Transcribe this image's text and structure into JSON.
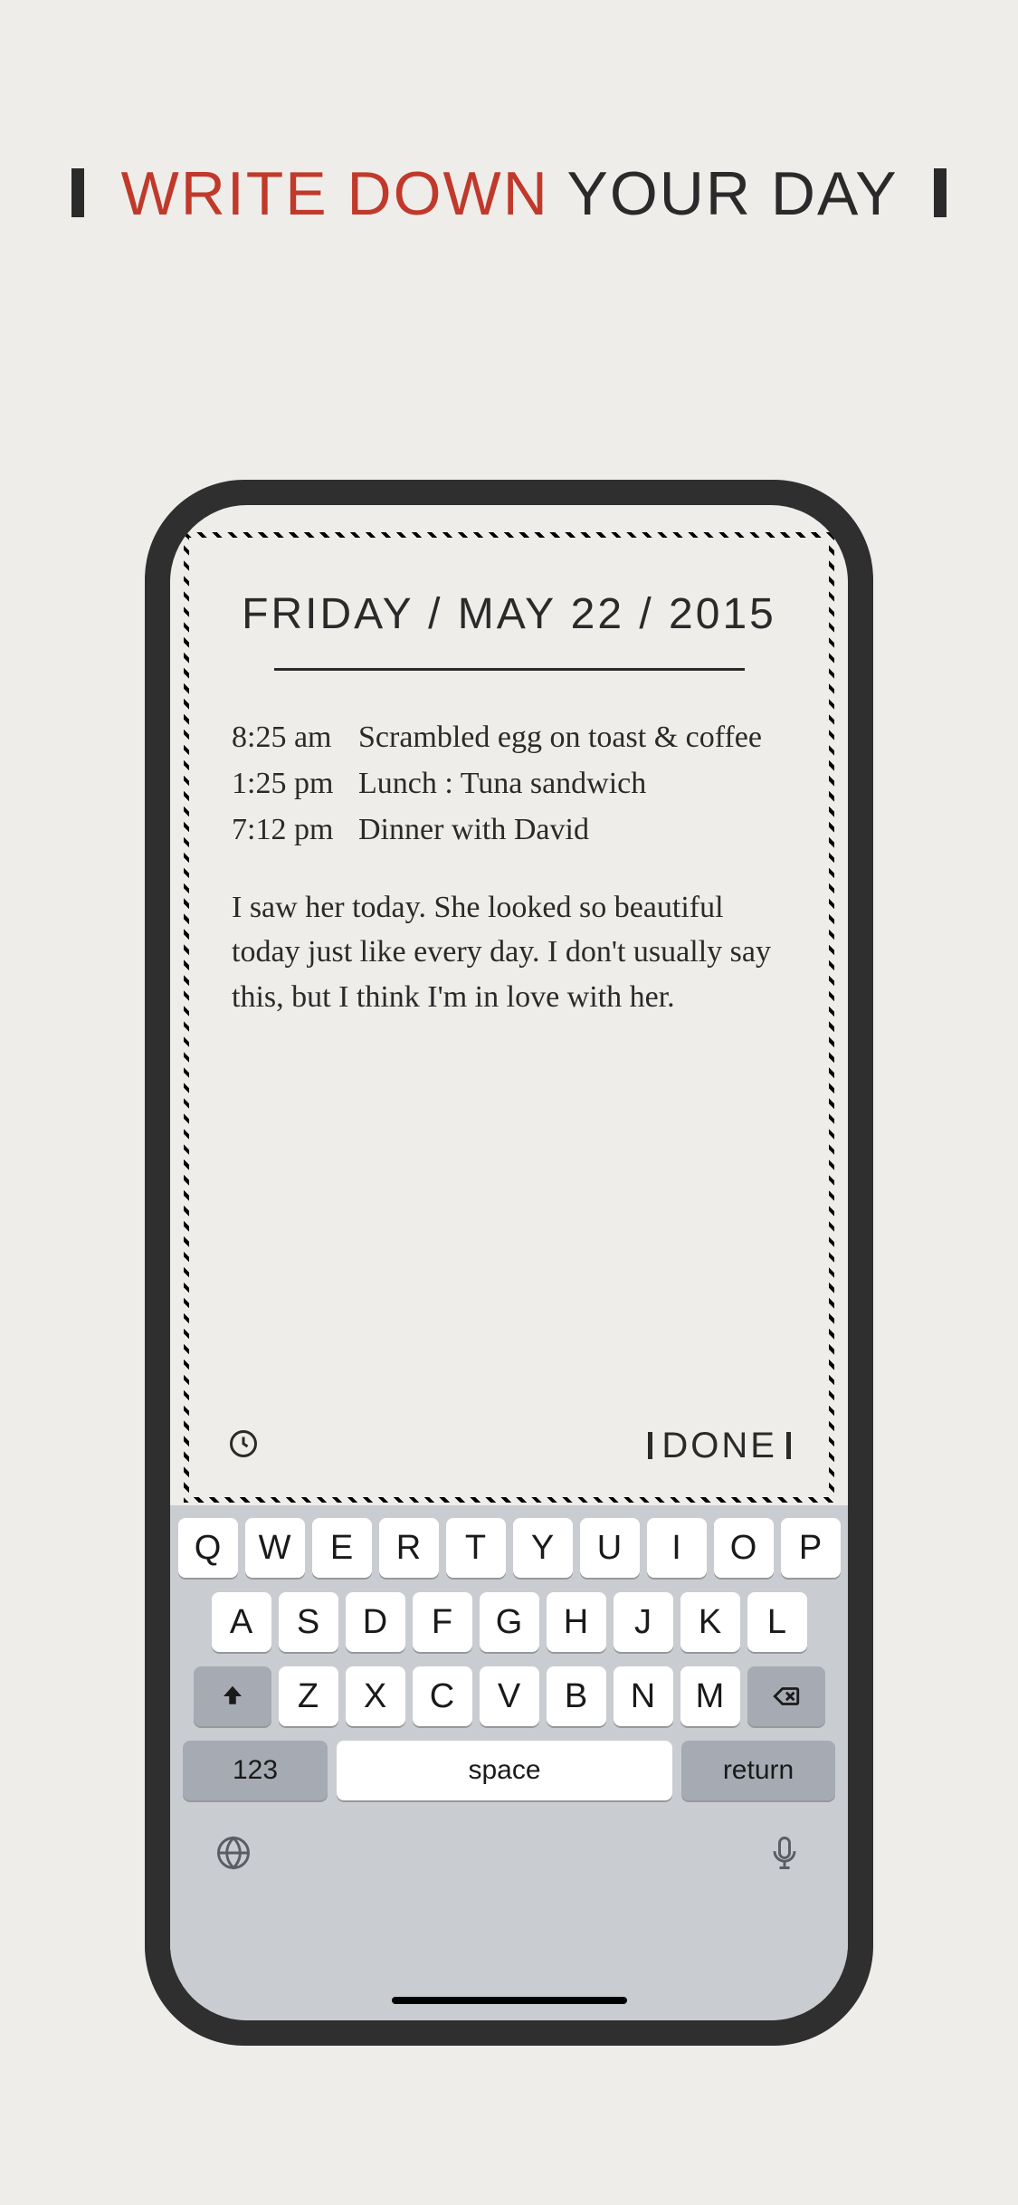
{
  "tagline": {
    "highlight": "WRITE DOWN",
    "rest": "YOUR DAY"
  },
  "journal": {
    "date": "FRIDAY / MAY 22 / 2015",
    "entries": [
      {
        "time": "8:25 am",
        "text": "Scrambled egg on toast & coffee"
      },
      {
        "time": "1:25 pm",
        "text": "Lunch : Tuna sandwich"
      },
      {
        "time": "7:12 pm",
        "text": "Dinner with David"
      }
    ],
    "paragraph": "I saw her today. She looked so beautiful today just like every day. I don't usually say this, but I think I'm in love with her.",
    "done_label": "DONE"
  },
  "keyboard": {
    "row1": [
      "Q",
      "W",
      "E",
      "R",
      "T",
      "Y",
      "U",
      "I",
      "O",
      "P"
    ],
    "row2": [
      "A",
      "S",
      "D",
      "F",
      "G",
      "H",
      "J",
      "K",
      "L"
    ],
    "row3": [
      "Z",
      "X",
      "C",
      "V",
      "B",
      "N",
      "M"
    ],
    "numbers_label": "123",
    "space_label": "space",
    "return_label": "return"
  }
}
